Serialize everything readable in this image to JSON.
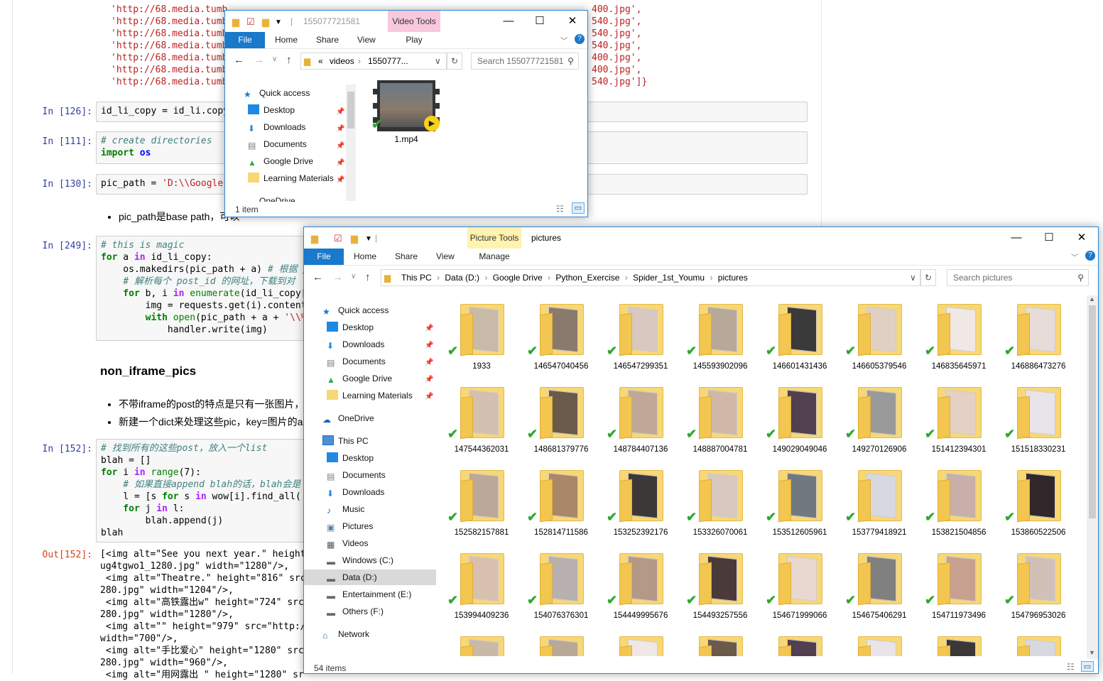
{
  "notebook": {
    "url_lines": [
      "'http://68.media.tumb",
      "'http://68.media.tumb",
      "'http://68.media.tumb",
      "'http://68.media.tumb",
      "'http://68.media.tumb",
      "'http://68.media.tumb",
      "'http://68.media.tumb"
    ],
    "url_tails": [
      "400.jpg',",
      "540.jpg',",
      "540.jpg',",
      "540.jpg',",
      "400.jpg',",
      "400.jpg',",
      "540.jpg']}"
    ],
    "cell126": {
      "prompt": "In [126]:",
      "code": "id_li_copy = id_li.copy"
    },
    "cell111": {
      "prompt": "In [111]:",
      "comment": "# create directories",
      "kw": "import",
      "module": "os"
    },
    "cell130": {
      "prompt": "In [130]:",
      "lhs": "pic_path = ",
      "str": "'D:\\\\Google"
    },
    "bullet1": "pic_path是base path，可以",
    "cell249": {
      "prompt": "In [249]:",
      "l1": "# this is magic",
      "l2a": "for",
      "l2b": " a ",
      "l2c": "in",
      "l2d": " id_li_copy:",
      "l3": "    os.makedirs(pic_path + a) ",
      "l3c": "# 根据 p",
      "l4": "    # 解析每个 post_id 的网址，下载到对",
      "l5a": "    for",
      "l5b": " b, i ",
      "l5c": "in",
      "l5d": " enumerate",
      "l5e": "(id_li_copy[",
      "l6": "        img = requests.get(i).content",
      "l7a": "        with",
      "l7b": " open",
      "l7c": "(pic_path + a + ",
      "l7d": "'\\\\%",
      "l8": "            handler.write(img)"
    },
    "heading": "non_iframe_pics",
    "bullet2": "不带iframe的post的特点是只有一张图片，",
    "bullet3": "新建一个dict来处理这些pic，key=图片的a",
    "cell152": {
      "prompt": "In [152]:",
      "l1": "# 找到所有的这些post，放入一个list",
      "l2": "blah = []",
      "l3a": "for",
      "l3b": " i ",
      "l3c": "in",
      "l3d": " range",
      "l3e": "(7):",
      "l4": "    # 如果直接append blah的话，blah会是",
      "l5a": "    l = [s ",
      "l5b": "for",
      "l5c": " s ",
      "l5d": "in",
      "l5e": " wow[i].find_all('",
      "l6a": "    for",
      "l6b": " j ",
      "l6c": "in",
      "l6d": " l:",
      "l7": "        blah.append(j)",
      "l8": "blah"
    },
    "out152": {
      "prompt": "Out[152]:",
      "lines": [
        "[<img alt=\"See you next year.\" height=",
        "ug4tgwo1_1280.jpg\" width=\"1280\"/>,",
        " <img alt=\"Theatre.\" height=\"816\" src=",
        "280.jpg\" width=\"1204\"/>,",
        " <img alt=\"高铁露出w\" height=\"724\" src",
        "280.jpg\" width=\"1280\"/>,",
        " <img alt=\"\" height=\"979\" src=\"http:/",
        "width=\"700\"/>,",
        " <img alt=\"手比爱心\" height=\"1280\" src",
        "280.jpg\" width=\"960\"/>,",
        " <img alt=\"用网露出 \" height=\"1280\" sr"
      ]
    }
  },
  "video_window": {
    "title": "155077721581",
    "context_tab": "Video Tools",
    "tabs": [
      "File",
      "Home",
      "Share",
      "View",
      "Play"
    ],
    "address": [
      "«",
      "videos",
      "1550777..."
    ],
    "search_placeholder": "Search 155077721581",
    "nav": [
      "Quick access",
      "Desktop",
      "Downloads",
      "Documents",
      "Google Drive",
      "Learning Materials",
      "OneDrive"
    ],
    "file_name": "1.mp4",
    "status": "1 item"
  },
  "pictures_window": {
    "title": "pictures",
    "context_tab": "Picture Tools",
    "tabs": [
      "File",
      "Home",
      "Share",
      "View",
      "Manage"
    ],
    "address": [
      "This PC",
      "Data (D:)",
      "Google Drive",
      "Python_Exercise",
      "Spider_1st_Youmu",
      "pictures"
    ],
    "search_placeholder": "Search pictures",
    "nav": {
      "quick_access": "Quick access",
      "qa_items": [
        "Desktop",
        "Downloads",
        "Documents",
        "Google Drive",
        "Learning Materials"
      ],
      "onedrive": "OneDrive",
      "this_pc": "This PC",
      "pc_items": [
        "Desktop",
        "Documents",
        "Downloads",
        "Music",
        "Pictures",
        "Videos",
        "Windows (C:)",
        "Data (D:)",
        "Entertainment (E:)",
        "Others (F:)"
      ],
      "network": "Network"
    },
    "folders": [
      "1933",
      "146547040456",
      "146547299351",
      "145593902096",
      "146601431436",
      "146605379546",
      "146835645971",
      "146886473276",
      "147544362031",
      "148681379776",
      "148784407136",
      "148887004781",
      "149029049046",
      "149270126906",
      "151412394301",
      "151518330231",
      "152582157881",
      "152814711586",
      "153252392176",
      "153326070061",
      "153512605961",
      "153779418921",
      "153821504856",
      "153860522506",
      "153994409236",
      "154076376301",
      "154449995676",
      "154493257556",
      "154671999066",
      "154675406291",
      "154711973496",
      "154796953026"
    ],
    "status": "54 items"
  }
}
